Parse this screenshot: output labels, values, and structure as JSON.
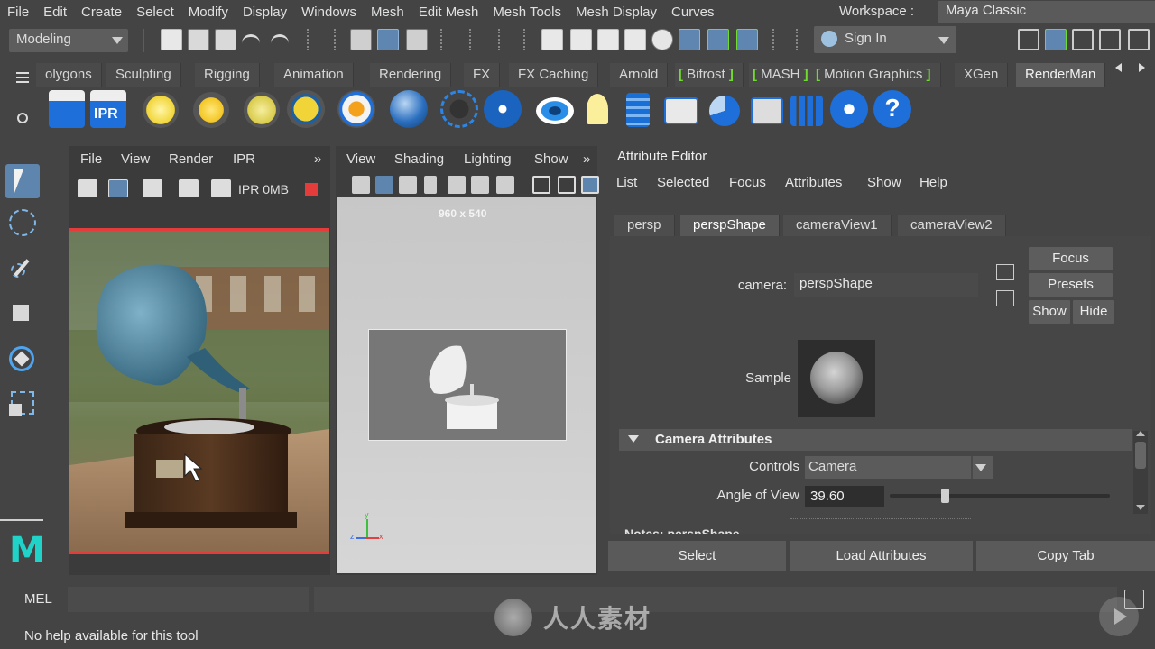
{
  "menubar": {
    "items": [
      "File",
      "Edit",
      "Create",
      "Select",
      "Modify",
      "Display",
      "Windows",
      "Mesh",
      "Edit Mesh",
      "Mesh Tools",
      "Mesh Display",
      "Curves"
    ],
    "workspace_label": "Workspace :",
    "workspace_value": "Maya Classic"
  },
  "statusline": {
    "mode": "Modeling",
    "signin": "Sign In"
  },
  "shelf": {
    "tabs": [
      "olygons",
      "Sculpting",
      "Rigging",
      "Animation",
      "Rendering",
      "FX",
      "FX Caching",
      "Arnold",
      "Bifrost",
      "MASH",
      "Motion Graphics",
      "XGen",
      "RenderMan"
    ],
    "active_tab": "RenderMan",
    "icons": [
      "render-icon",
      "ipr-render-icon",
      "point-light-icon",
      "sun-light-icon",
      "env-light-icon",
      "area-light-icon",
      "pixar-light-icon",
      "sphere-material-icon",
      "dashed-circle-icon",
      "bulb-icon",
      "eye-icon",
      "light-bulb-icon",
      "calculator-icon",
      "share-icon",
      "pie-icon",
      "image-icon",
      "bar-chart-icon",
      "plug-icon",
      "help-icon"
    ],
    "ipr_label": "IPR"
  },
  "renderview": {
    "menus": [
      "File",
      "View",
      "Render",
      "IPR"
    ],
    "ipr_mem": "IPR 0MB",
    "expand": "»"
  },
  "viewport": {
    "menus": [
      "View",
      "Shading",
      "Lighting",
      "Show"
    ],
    "expand": "»",
    "resolution": "960 x 540",
    "axis_labels": {
      "x": "x",
      "y": "y",
      "z": "z"
    }
  },
  "attribute_editor": {
    "title": "Attribute Editor",
    "menus": [
      "List",
      "Selected",
      "Focus",
      "Attributes",
      "Show",
      "Help"
    ],
    "tabs": [
      "persp",
      "perspShape",
      "cameraView1",
      "cameraView2"
    ],
    "active_tab": "perspShape",
    "camera_label": "camera:",
    "camera_value": "perspShape",
    "buttons": {
      "focus": "Focus",
      "presets": "Presets",
      "show": "Show",
      "hide": "Hide"
    },
    "sample_label": "Sample",
    "section_title": "Camera Attributes",
    "controls_label": "Controls",
    "controls_value": "Camera",
    "aov_label": "Angle of View",
    "aov_value": "39.60",
    "aov_slider_fraction": 0.25,
    "notes_label": "Notes:  perspShape",
    "bottom_buttons": {
      "select": "Select",
      "load": "Load Attributes",
      "copy": "Copy Tab"
    }
  },
  "cmdline": {
    "label": "MEL"
  },
  "helpline": {
    "text": "No help available for this tool"
  },
  "watermark": {
    "text": "人人素材"
  },
  "colors": {
    "accent_blue": "#5d85ae",
    "bracket_green": "#6fdc2e",
    "render_border_red": "#e43b3b",
    "maya_teal": "#1fd3c9"
  }
}
